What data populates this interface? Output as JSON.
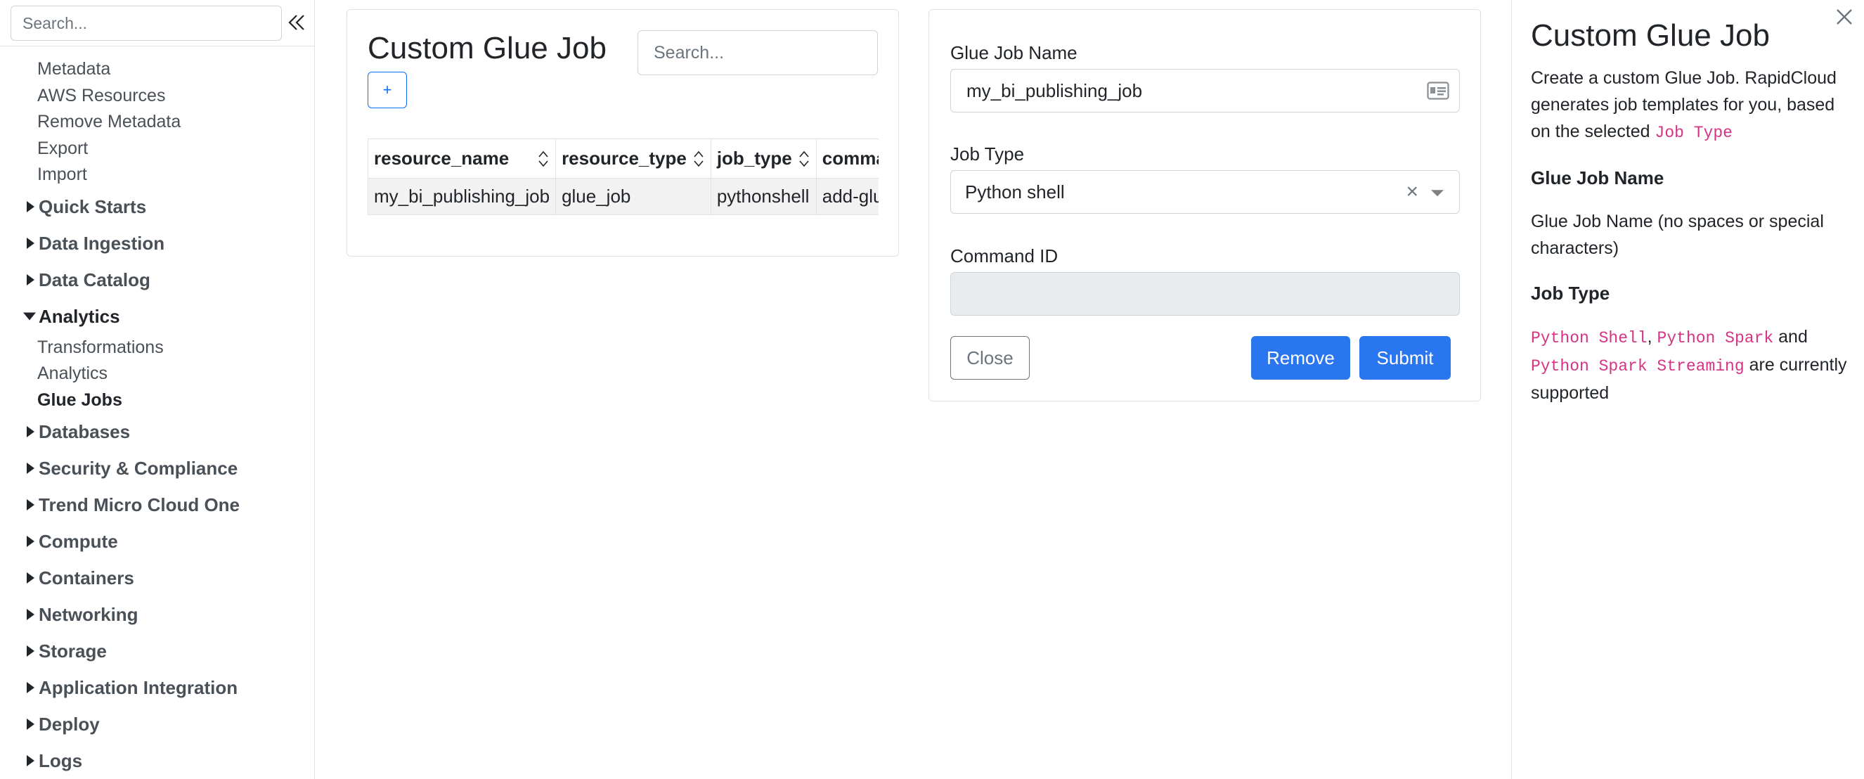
{
  "sidebar": {
    "search_placeholder": "Search...",
    "sub_items_top": [
      "Metadata",
      "AWS Resources",
      "Remove Metadata",
      "Export",
      "Import"
    ],
    "groups_before": [
      "Quick Starts",
      "Data Ingestion",
      "Data Catalog"
    ],
    "open_group": "Analytics",
    "open_group_items": [
      "Transformations",
      "Analytics",
      "Glue Jobs"
    ],
    "active_item": "Glue Jobs",
    "groups_after": [
      "Databases",
      "Security & Compliance",
      "Trend Micro Cloud One",
      "Compute",
      "Containers",
      "Networking",
      "Storage",
      "Application Integration",
      "Deploy",
      "Logs"
    ]
  },
  "table_panel": {
    "title": "Custom Glue Job",
    "add_label": "+",
    "search_placeholder": "Search...",
    "columns": [
      "resource_name",
      "resource_type",
      "job_type",
      "command_id"
    ],
    "rows": [
      [
        "my_bi_publishing_job",
        "glue_job",
        "pythonshell",
        "add-glue-job"
      ]
    ]
  },
  "form": {
    "name_label": "Glue Job Name",
    "name_value": "my_bi_publishing_job",
    "type_label": "Job Type",
    "type_value": "Python shell",
    "command_label": "Command ID",
    "command_value": "",
    "close_label": "Close",
    "remove_label": "Remove",
    "submit_label": "Submit"
  },
  "help": {
    "title": "Custom Glue Job",
    "intro_text": "Create a custom Glue Job. RapidCloud generates job templates for you, based on the selected ",
    "intro_code": "Job Type",
    "name_heading": "Glue Job Name",
    "name_desc": "Glue Job Name (no spaces or special characters)",
    "type_heading": "Job Type",
    "type_code_1": "Python Shell",
    "type_sep": ", ",
    "type_code_2": "Python Spark",
    "type_and": " and ",
    "type_code_3": "Python Spark Streaming",
    "type_tail": " are currently supported"
  },
  "icons": {
    "collapse": "double-chevron-left-icon",
    "card": "id-card-icon",
    "sort": "sort-icon",
    "clear": "clear-icon",
    "close": "close-icon"
  },
  "colors": {
    "primary": "#2a76f0",
    "code": "#d63384"
  }
}
